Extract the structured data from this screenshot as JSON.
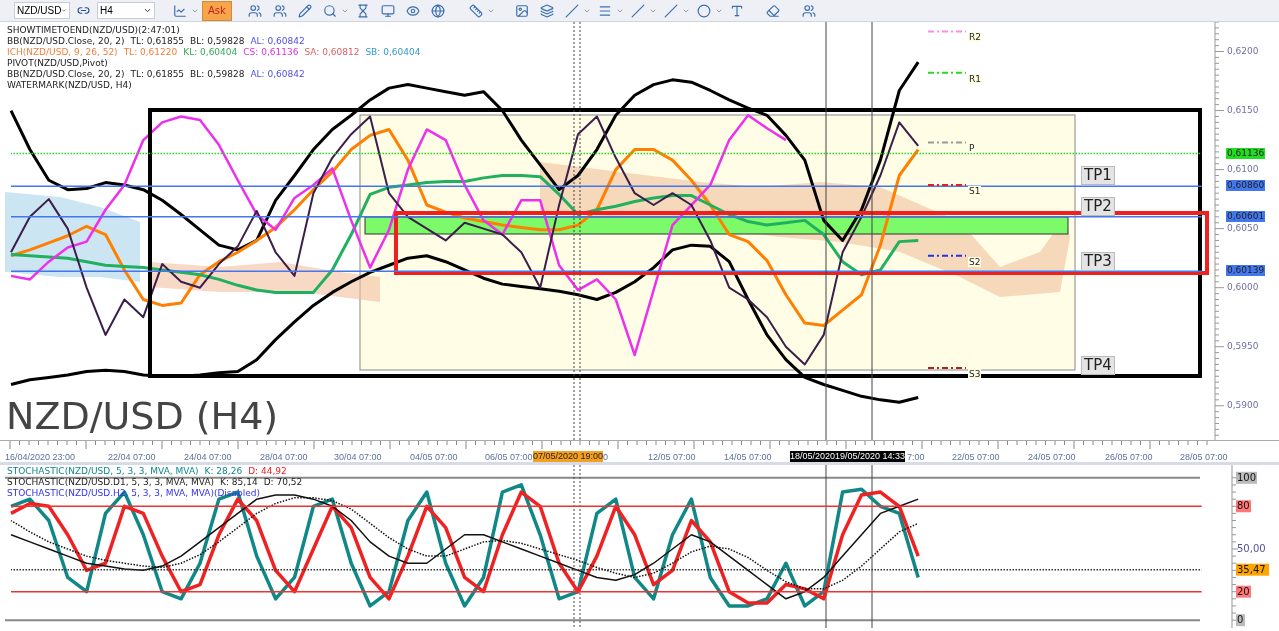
{
  "toolbar": {
    "symbol": "NZD/USD",
    "timeframe": "H4",
    "ask_button": {
      "label": "Ask",
      "selected": true
    }
  },
  "main_chart": {
    "legend": [
      {
        "parts": [
          "SHOWTIMETOEND(NZD/USD)(2:47:01)"
        ]
      },
      {
        "parts": [
          "BB(NZD/USD.Close, 20, 2)",
          "TL: 0,61855",
          "BL: 0,59828",
          "AL: 0,60842"
        ]
      },
      {
        "parts": [
          "ICH(NZD/USD, 9, 26, 52)",
          "TL: 0,61220",
          "KL: 0,60404",
          "CS: 0,61136",
          "SA: 0,60812",
          "SB: 0,60404"
        ]
      },
      {
        "parts": [
          "PIVOT(NZD/USD,Pivot)"
        ]
      },
      {
        "parts": [
          "BB(NZD/USD.Close, 20, 2)",
          "TL: 0,61855",
          "BL: 0,59828",
          "AL: 0,60842"
        ]
      },
      {
        "parts": [
          "WATERMARK(NZD/USD, H4)"
        ]
      }
    ],
    "watermark": "NZD/USD (H4)",
    "price_tags": [
      {
        "text": "0,61136"
      },
      {
        "text": "0,60860"
      },
      {
        "text": "0,60601"
      },
      {
        "text": "0,60139"
      }
    ],
    "targets": [
      {
        "label": "TP1"
      },
      {
        "label": "TP2"
      },
      {
        "label": "TP3"
      },
      {
        "label": "TP4"
      }
    ],
    "pivots": [
      {
        "label": "R2"
      },
      {
        "label": "R1"
      },
      {
        "label": "P"
      },
      {
        "label": "S1"
      },
      {
        "label": "S2"
      },
      {
        "label": "S3"
      }
    ],
    "chart_data": {
      "type": "line",
      "ylim": [
        0.5871,
        0.6225
      ],
      "grid": true,
      "yticks": [
        {
          "value": 0.59,
          "label": "0,5900"
        },
        {
          "value": 0.595,
          "label": "0,5950"
        },
        {
          "value": 0.6,
          "label": "0,6000"
        },
        {
          "value": 0.605,
          "label": "0,6050"
        },
        {
          "value": 0.61,
          "label": "0,6100"
        },
        {
          "value": 0.615,
          "label": "0,6150"
        },
        {
          "value": 0.62,
          "label": "0,6200"
        }
      ],
      "categories": [
        null,
        null,
        null,
        null,
        null,
        null,
        null,
        null,
        null,
        null,
        null,
        null,
        null,
        null,
        null,
        null,
        null,
        null,
        null,
        null,
        null,
        null,
        null,
        null,
        null,
        null,
        null,
        null,
        null,
        null,
        null,
        null,
        null,
        null,
        null,
        null,
        null,
        null,
        null,
        null,
        null,
        null,
        null,
        null,
        null,
        null,
        null,
        null,
        null,
        null,
        null,
        null,
        null,
        null,
        null,
        null,
        null,
        null,
        null,
        null,
        null,
        null,
        null,
        null
      ],
      "series": [
        {
          "color": "#000000",
          "values": [
            0.615,
            0.6117,
            0.6091,
            0.6083,
            0.6084,
            0.6089,
            0.6087,
            0.6083,
            0.6074,
            0.6062,
            0.6049,
            0.6036,
            0.6032,
            0.604,
            0.6074,
            0.6095,
            0.6117,
            0.6134,
            0.6146,
            0.6159,
            0.6169,
            0.6172,
            0.6169,
            0.6166,
            0.6163,
            0.6166,
            0.615,
            0.6125,
            0.6104,
            0.6083,
            0.6095,
            0.6117,
            0.6146,
            0.6163,
            0.6172,
            0.6176,
            0.6174,
            0.6167,
            0.6159,
            0.6152,
            0.6146,
            0.6129,
            0.6108,
            0.6057,
            0.604,
            0.6066,
            0.6108,
            0.6167,
            0.6191,
            null,
            null,
            null,
            null,
            null,
            null,
            null,
            null,
            null,
            null,
            null,
            null,
            null,
            null,
            null
          ]
        },
        {
          "color": "#000000",
          "values": [
            0.5918,
            0.5922,
            0.5924,
            0.5926,
            0.5929,
            0.593,
            0.5929,
            0.5926,
            0.5925,
            0.5925,
            0.5926,
            0.5928,
            0.5929,
            0.5939,
            0.5956,
            0.5971,
            0.5985,
            0.5996,
            0.6005,
            0.6013,
            0.6019,
            0.6025,
            0.6027,
            0.6022,
            0.6015,
            0.6008,
            0.6003,
            0.6001,
            0.5999,
            0.5997,
            0.5994,
            0.599,
            0.5996,
            0.6005,
            0.6017,
            0.6032,
            0.6036,
            0.6035,
            0.6022,
            0.599,
            0.596,
            0.5939,
            0.5924,
            0.5918,
            0.5913,
            0.5908,
            0.5905,
            0.5903,
            0.5907,
            null,
            null,
            null,
            null,
            null,
            null,
            null,
            null,
            null,
            null,
            null,
            null,
            null,
            null,
            null
          ]
        },
        {
          "color": "#ff8000",
          "values": [
            0.6027,
            0.6032,
            0.6038,
            0.6044,
            0.6052,
            0.6045,
            0.6015,
            0.599,
            0.5985,
            0.5987,
            0.6011,
            0.6022,
            0.603,
            0.604,
            0.6051,
            0.6066,
            0.6083,
            0.6098,
            0.6117,
            0.6129,
            0.6134,
            0.6108,
            0.607,
            0.6064,
            0.6059,
            0.6056,
            0.6053,
            0.6051,
            0.6049,
            0.6049,
            0.6053,
            0.6066,
            0.61,
            0.6117,
            0.6117,
            0.6108,
            0.6091,
            0.607,
            0.6045,
            0.6039,
            0.6023,
            0.5994,
            0.597,
            0.5968,
            0.5981,
            0.5994,
            0.6036,
            0.6095,
            0.6117,
            null,
            null,
            null,
            null,
            null,
            null,
            null,
            null,
            null,
            null,
            null,
            null,
            null,
            null,
            null
          ]
        },
        {
          "color": "#20b060",
          "values": [
            0.6028,
            0.6027,
            0.6026,
            0.6025,
            0.6022,
            0.6019,
            0.6018,
            0.6017,
            0.6015,
            0.6013,
            0.6011,
            0.6007,
            0.6002,
            0.5998,
            0.5996,
            0.5996,
            0.5996,
            0.6015,
            0.6045,
            0.6079,
            0.6085,
            0.6087,
            0.6089,
            0.609,
            0.609,
            0.6093,
            0.6095,
            0.6095,
            0.6094,
            0.6079,
            0.6062,
            0.6066,
            0.6069,
            0.6073,
            0.6076,
            0.6078,
            0.6078,
            0.607,
            0.6062,
            0.6056,
            0.6053,
            0.6055,
            0.6057,
            0.6045,
            0.6022,
            0.6011,
            0.6015,
            0.6039,
            0.604,
            null,
            null,
            null,
            null,
            null,
            null,
            null,
            null,
            null,
            null,
            null,
            null,
            null,
            null,
            null
          ]
        },
        {
          "color": "#ee30ee",
          "values": [
            0.601,
            0.6007,
            0.6022,
            0.6034,
            0.6039,
            0.6066,
            0.6087,
            0.6125,
            0.614,
            0.6145,
            0.6142,
            0.6121,
            0.6091,
            0.6062,
            0.6049,
            0.6076,
            0.6087,
            0.6101,
            0.6057,
            0.6017,
            0.6049,
            0.61,
            0.6134,
            0.6125,
            0.6087,
            0.6057,
            0.6045,
            0.6074,
            0.6074,
            0.6019,
            0.5998,
            0.6007,
            0.599,
            0.5943,
            0.5998,
            0.6053,
            0.607,
            0.6087,
            0.6125,
            0.6146,
            0.6135,
            0.6125,
            null,
            null,
            null,
            null,
            null,
            null,
            null,
            null,
            null,
            null,
            null,
            null,
            null,
            null,
            null,
            null,
            null,
            null,
            null,
            null,
            null,
            null
          ]
        },
        {
          "color": "#3b1f4a",
          "values": [
            0.603,
            0.606,
            0.6075,
            0.605,
            0.6,
            0.596,
            0.599,
            0.5975,
            0.602,
            0.6005,
            0.6,
            0.602,
            0.6035,
            0.6065,
            0.603,
            0.601,
            0.608,
            0.611,
            0.613,
            0.6145,
            0.608,
            0.606,
            0.605,
            0.604,
            0.6055,
            0.605,
            0.6045,
            0.603,
            0.6,
            0.607,
            0.613,
            0.6145,
            0.611,
            0.608,
            0.607,
            0.608,
            0.607,
            0.604,
            0.6,
            0.599,
            0.5975,
            0.595,
            0.5935,
            0.596,
            0.603,
            0.606,
            0.6095,
            0.614,
            0.612,
            null,
            null,
            null,
            null,
            null,
            null,
            null,
            null,
            null,
            null,
            null,
            null,
            null,
            null,
            null
          ]
        },
        {
          "color": "#22dd22",
          "line_style": "dotted",
          "values": [
            0.61136,
            0.61136,
            0.61136,
            0.61136,
            0.61136,
            0.61136,
            0.61136,
            0.61136,
            0.61136,
            0.61136,
            0.61136,
            0.61136,
            0.61136,
            0.61136,
            0.61136,
            0.61136,
            0.61136,
            0.61136,
            0.61136,
            0.61136,
            0.61136,
            0.61136,
            0.61136,
            0.61136,
            0.61136,
            0.61136,
            0.61136,
            0.61136,
            0.61136,
            0.61136,
            0.61136,
            0.61136,
            0.61136,
            0.61136,
            0.61136,
            0.61136,
            0.61136,
            0.61136,
            0.61136,
            0.61136,
            0.61136,
            0.61136,
            0.61136,
            0.61136,
            0.61136,
            0.61136,
            0.61136,
            0.61136,
            0.61136,
            0.61136,
            0.61136,
            0.61136,
            0.61136,
            0.61136,
            0.61136,
            0.61136,
            0.61136,
            0.61136,
            0.61136,
            0.61136,
            0.61136,
            0.61136,
            0.61136,
            0.61136
          ]
        },
        {
          "color": "#4477ee",
          "values": [
            0.6086,
            0.6086,
            0.6086,
            0.6086,
            0.6086,
            0.6086,
            0.6086,
            0.6086,
            0.6086,
            0.6086,
            0.6086,
            0.6086,
            0.6086,
            0.6086,
            0.6086,
            0.6086,
            0.6086,
            0.6086,
            0.6086,
            0.6086,
            0.6086,
            0.6086,
            0.6086,
            0.6086,
            0.6086,
            0.6086,
            0.6086,
            0.6086,
            0.6086,
            0.6086,
            0.6086,
            0.6086,
            0.6086,
            0.6086,
            0.6086,
            0.6086,
            0.6086,
            0.6086,
            0.6086,
            0.6086,
            0.6086,
            0.6086,
            0.6086,
            0.6086,
            0.6086,
            0.6086,
            0.6086,
            0.6086,
            0.6086,
            0.6086,
            0.6086,
            0.6086,
            0.6086,
            0.6086,
            0.6086,
            0.6086,
            0.6086,
            0.6086,
            0.6086,
            0.6086,
            0.6086,
            0.6086,
            0.6086,
            0.6086
          ]
        },
        {
          "color": "#4477ee",
          "values": [
            0.60601,
            0.60601,
            0.60601,
            0.60601,
            0.60601,
            0.60601,
            0.60601,
            0.60601,
            0.60601,
            0.60601,
            0.60601,
            0.60601,
            0.60601,
            0.60601,
            0.60601,
            0.60601,
            0.60601,
            0.60601,
            0.60601,
            0.60601,
            0.60601,
            0.60601,
            0.60601,
            0.60601,
            0.60601,
            0.60601,
            0.60601,
            0.60601,
            0.60601,
            0.60601,
            0.60601,
            0.60601,
            0.60601,
            0.60601,
            0.60601,
            0.60601,
            0.60601,
            0.60601,
            0.60601,
            0.60601,
            0.60601,
            0.60601,
            0.60601,
            0.60601,
            0.60601,
            0.60601,
            0.60601,
            0.60601,
            0.60601,
            0.60601,
            0.60601,
            0.60601,
            0.60601,
            0.60601,
            0.60601,
            0.60601,
            0.60601,
            0.60601,
            0.60601,
            0.60601,
            0.60601,
            0.60601,
            0.60601,
            0.60601
          ]
        },
        {
          "color": "#4477ee",
          "values": [
            0.60139,
            0.60139,
            0.60139,
            0.60139,
            0.60139,
            0.60139,
            0.60139,
            0.60139,
            0.60139,
            0.60139,
            0.60139,
            0.60139,
            0.60139,
            0.60139,
            0.60139,
            0.60139,
            0.60139,
            0.60139,
            0.60139,
            0.60139,
            0.60139,
            0.60139,
            0.60139,
            0.60139,
            0.60139,
            0.60139,
            0.60139,
            0.60139,
            0.60139,
            0.60139,
            0.60139,
            0.60139,
            0.60139,
            0.60139,
            0.60139,
            0.60139,
            0.60139,
            0.60139,
            0.60139,
            0.60139,
            0.60139,
            0.60139,
            0.60139,
            0.60139,
            0.60139,
            0.60139,
            0.60139,
            0.60139,
            0.60139,
            0.60139,
            0.60139,
            0.60139,
            0.60139,
            0.60139,
            0.60139,
            0.60139,
            0.60139,
            0.60139,
            0.60139,
            0.60139,
            0.60139,
            0.60139,
            0.60139,
            0.60139
          ]
        }
      ]
    }
  },
  "time_axis": {
    "labels": [
      "16/04/2020 23:00",
      "22/04 07:00",
      "24/04 07:00",
      "28/04 07:00",
      "30/04 07:00",
      "04/05 07:00",
      "06/05 07:00",
      "0",
      "12/05 07:00",
      "14/05 07:00",
      "7:00",
      "22/05 07:00",
      "24/05 07:00",
      "26/05 07:00",
      "28/05 07:00"
    ],
    "cursor_labels": [
      {
        "text": "07/05/2020 19:00",
        "kind": "highlight"
      },
      {
        "text": "18/05/2020",
        "kind": "dark"
      },
      {
        "text": "19/05/2020 14:33",
        "kind": "dark"
      }
    ]
  },
  "stochastic": {
    "legend": [
      {
        "parts": [
          "STOCHASTIC(NZD/USD, 5, 3, 3, MVA, MVA)",
          "K: 28,26",
          "D: 44,92"
        ]
      },
      {
        "parts": [
          "STOCHASTIC(NZD/USD.D1, 5, 3, 3, MVA, MVA)",
          "K: 85,14",
          "D: 70,52"
        ]
      },
      {
        "parts": [
          "STOCHASTIC(NZD/USD.H2, 5, 3, 3, MVA, MVA)(Disabled)"
        ]
      }
    ],
    "chart_data": {
      "type": "line",
      "ylim": [
        -5.5,
        109
      ],
      "grid": true,
      "yticks": [
        {
          "value": 100,
          "label": "100"
        },
        {
          "value": 80,
          "label": "80"
        },
        {
          "value": 50,
          "label": "50,00"
        },
        {
          "value": 35.47,
          "label": "35,47"
        },
        {
          "value": 20,
          "label": "20"
        },
        {
          "value": 0,
          "label": "0"
        }
      ],
      "categories": [
        null,
        null,
        null,
        null,
        null,
        null,
        null,
        null,
        null,
        null,
        null,
        null,
        null,
        null,
        null,
        null,
        null,
        null,
        null,
        null,
        null,
        null,
        null,
        null,
        null,
        null,
        null,
        null,
        null,
        null,
        null,
        null,
        null,
        null,
        null,
        null,
        null,
        null,
        null,
        null,
        null,
        null,
        null,
        null,
        null,
        null,
        null,
        null,
        null,
        null,
        null,
        null,
        null,
        null,
        null,
        null,
        null,
        null,
        null,
        null,
        null,
        null,
        null,
        null
      ],
      "series": [
        {
          "color": "#118888",
          "values": [
            80,
            85,
            70,
            30,
            20,
            75,
            90,
            60,
            20,
            15,
            40,
            85,
            90,
            45,
            15,
            30,
            80,
            85,
            40,
            10,
            20,
            70,
            90,
            40,
            10,
            30,
            90,
            95,
            60,
            15,
            20,
            75,
            85,
            30,
            15,
            60,
            85,
            30,
            10,
            10,
            15,
            40,
            10,
            20,
            90,
            92,
            80,
            75,
            30,
            null,
            null,
            null,
            null,
            null,
            null,
            null,
            null,
            null,
            null,
            null,
            null,
            null,
            null,
            null
          ]
        },
        {
          "color": "#ee2222",
          "values": [
            75,
            82,
            80,
            60,
            35,
            40,
            80,
            75,
            45,
            20,
            25,
            60,
            85,
            70,
            35,
            20,
            50,
            80,
            65,
            30,
            15,
            45,
            80,
            65,
            30,
            20,
            60,
            90,
            80,
            40,
            20,
            45,
            80,
            60,
            25,
            35,
            70,
            55,
            20,
            12,
            12,
            25,
            22,
            15,
            60,
            88,
            90,
            80,
            45,
            null,
            null,
            null,
            null,
            null,
            null,
            null,
            null,
            null,
            null,
            null,
            null,
            null,
            null,
            null
          ]
        },
        {
          "color": "#111111",
          "values": [
            60,
            55,
            50,
            45,
            40,
            38,
            36,
            35,
            38,
            45,
            55,
            65,
            75,
            85,
            88,
            88,
            85,
            80,
            70,
            55,
            45,
            40,
            40,
            50,
            60,
            60,
            55,
            50,
            45,
            40,
            35,
            30,
            28,
            32,
            40,
            50,
            60,
            55,
            45,
            35,
            25,
            15,
            20,
            30,
            45,
            60,
            75,
            80,
            85,
            null,
            null,
            null,
            null,
            null,
            null,
            null,
            null,
            null,
            null,
            null,
            null,
            null,
            null,
            null
          ]
        },
        {
          "color": "#111111",
          "line_style": "dotted",
          "values": [
            70,
            62,
            55,
            50,
            45,
            42,
            40,
            38,
            37,
            40,
            46,
            55,
            65,
            75,
            82,
            86,
            86,
            84,
            78,
            68,
            58,
            50,
            45,
            45,
            50,
            55,
            56,
            54,
            50,
            46,
            42,
            37,
            33,
            30,
            33,
            40,
            48,
            52,
            50,
            44,
            35,
            27,
            22,
            22,
            28,
            38,
            50,
            62,
            68,
            null,
            null,
            null,
            null,
            null,
            null,
            null,
            null,
            null,
            null,
            null,
            null,
            null,
            null,
            null
          ]
        },
        {
          "color": "#ee3333",
          "values": [
            80,
            80,
            80,
            80,
            80,
            80,
            80,
            80,
            80,
            80,
            80,
            80,
            80,
            80,
            80,
            80,
            80,
            80,
            80,
            80,
            80,
            80,
            80,
            80,
            80,
            80,
            80,
            80,
            80,
            80,
            80,
            80,
            80,
            80,
            80,
            80,
            80,
            80,
            80,
            80,
            80,
            80,
            80,
            80,
            80,
            80,
            80,
            80,
            80,
            80,
            80,
            80,
            80,
            80,
            80,
            80,
            80,
            80,
            80,
            80,
            80,
            80,
            80,
            80
          ]
        },
        {
          "color": "#333333",
          "line_style": "dotted",
          "values": [
            35.47,
            35.47,
            35.47,
            35.47,
            35.47,
            35.47,
            35.47,
            35.47,
            35.47,
            35.47,
            35.47,
            35.47,
            35.47,
            35.47,
            35.47,
            35.47,
            35.47,
            35.47,
            35.47,
            35.47,
            35.47,
            35.47,
            35.47,
            35.47,
            35.47,
            35.47,
            35.47,
            35.47,
            35.47,
            35.47,
            35.47,
            35.47,
            35.47,
            35.47,
            35.47,
            35.47,
            35.47,
            35.47,
            35.47,
            35.47,
            35.47,
            35.47,
            35.47,
            35.47,
            35.47,
            35.47,
            35.47,
            35.47,
            35.47,
            35.47,
            35.47,
            35.47,
            35.47,
            35.47,
            35.47,
            35.47,
            35.47,
            35.47,
            35.47,
            35.47,
            35.47,
            35.47,
            35.47,
            35.47
          ]
        },
        {
          "color": "#ee3333",
          "values": [
            20,
            20,
            20,
            20,
            20,
            20,
            20,
            20,
            20,
            20,
            20,
            20,
            20,
            20,
            20,
            20,
            20,
            20,
            20,
            20,
            20,
            20,
            20,
            20,
            20,
            20,
            20,
            20,
            20,
            20,
            20,
            20,
            20,
            20,
            20,
            20,
            20,
            20,
            20,
            20,
            20,
            20,
            20,
            20,
            20,
            20,
            20,
            20,
            20,
            20,
            20,
            20,
            20,
            20,
            20,
            20,
            20,
            20,
            20,
            20,
            20,
            20,
            20,
            20
          ]
        }
      ]
    }
  }
}
